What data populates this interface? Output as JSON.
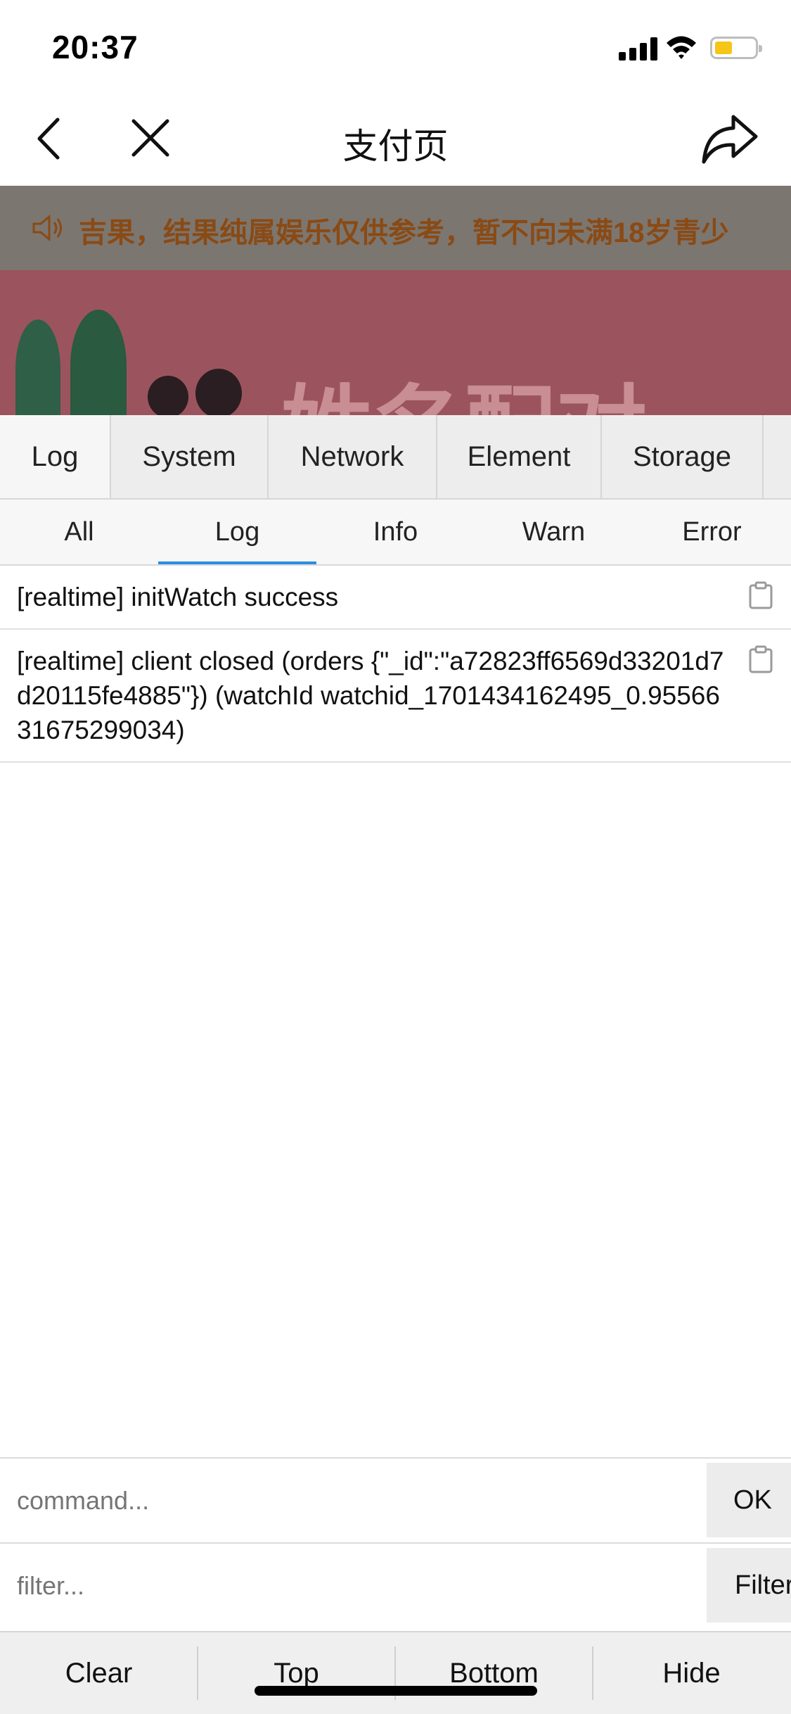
{
  "status_bar": {
    "time": "20:37",
    "battery_color": "#f5c518"
  },
  "nav": {
    "title": "支付页",
    "icons": [
      "chevron-left-icon",
      "close-icon",
      "share-icon"
    ]
  },
  "page": {
    "notice_text": "吉果，结果纯属娱乐仅供参考，暂不向未满18岁青少",
    "banner_text": "姓名配对"
  },
  "console": {
    "tabs": [
      {
        "label": "Log",
        "active": true
      },
      {
        "label": "System"
      },
      {
        "label": "Network"
      },
      {
        "label": "Element"
      },
      {
        "label": "Storage"
      }
    ],
    "subtabs": [
      {
        "label": "All"
      },
      {
        "label": "Log",
        "active": true
      },
      {
        "label": "Info"
      },
      {
        "label": "Warn"
      },
      {
        "label": "Error"
      }
    ],
    "logs": [
      {
        "text": "[realtime] initWatch success"
      },
      {
        "text": "[realtime] client closed (orders {\"_id\":\"a72823ff6569d33201d7d20115fe4885\"}) (watchId watchid_1701434162495_0.9556631675299034)"
      }
    ],
    "command": {
      "placeholder": "command...",
      "button": "OK"
    },
    "filter": {
      "placeholder": "filter...",
      "button": "Filter"
    },
    "toolbar": [
      "Clear",
      "Top",
      "Bottom",
      "Hide"
    ],
    "accent_color": "#2b8fe0"
  }
}
